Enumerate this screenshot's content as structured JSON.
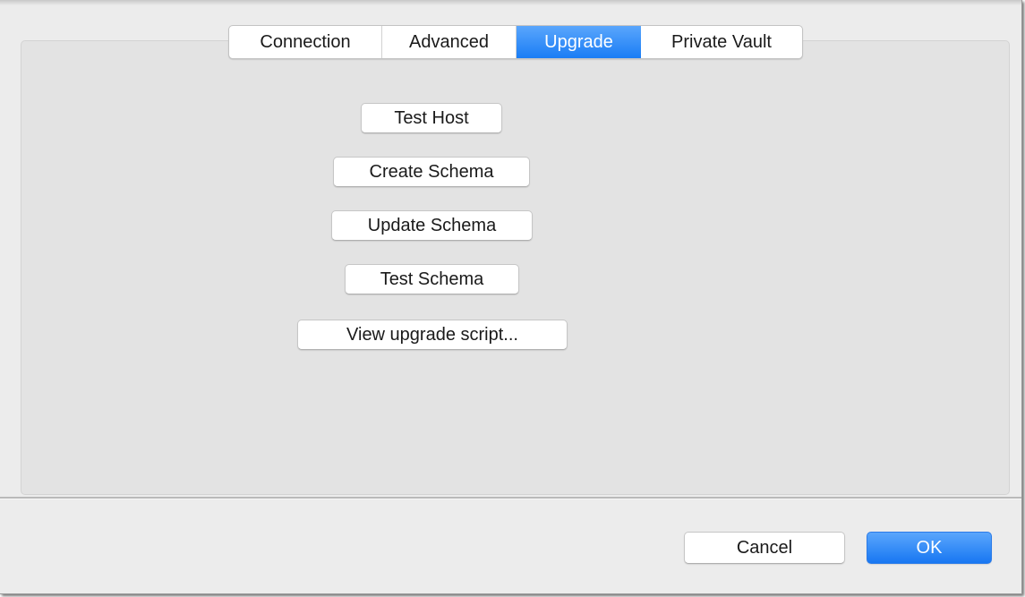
{
  "tabs": [
    {
      "label": "Connection",
      "active": false
    },
    {
      "label": "Advanced",
      "active": false
    },
    {
      "label": "Upgrade",
      "active": true
    },
    {
      "label": "Private Vault",
      "active": false
    }
  ],
  "upgrade": {
    "test_host": "Test Host",
    "create_schema": "Create Schema",
    "update_schema": "Update Schema",
    "test_schema": "Test Schema",
    "view_upgrade_script": "View upgrade script..."
  },
  "footer": {
    "cancel": "Cancel",
    "ok": "OK"
  },
  "colors": {
    "accent": "#1a7df5",
    "panel_background": "#e3e3e3",
    "window_background": "#ececec"
  }
}
